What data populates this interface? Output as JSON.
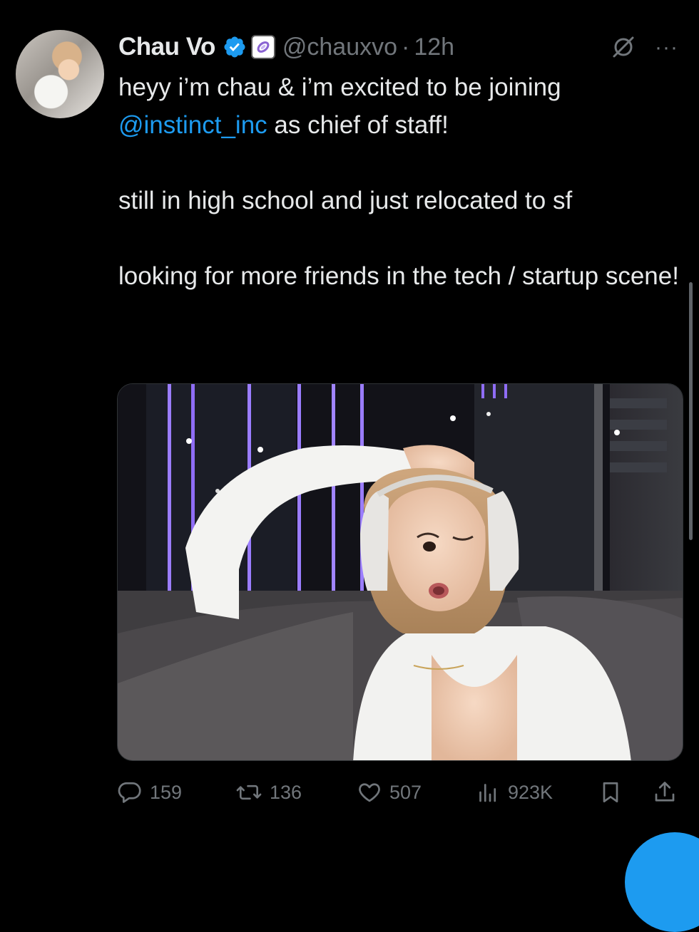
{
  "tweet": {
    "display_name": "Chau Vo",
    "handle": "@chauxvo",
    "separator": "·",
    "time": "12h",
    "more_label": "···",
    "text": {
      "line1_before": "heyy i’m chau & i’m excited to be joining",
      "mention": "@instinct_inc",
      "line1_after": " as chief of staff!",
      "para2": "still in high school and just relocated to sf",
      "para3": "looking for more friends in the tech / startup scene!"
    }
  },
  "actions": {
    "replies": "159",
    "reposts": "136",
    "likes": "507",
    "views": "923K"
  },
  "icons": {
    "verified": "verified-badge-icon",
    "affiliation": "affiliate-org-icon",
    "grok": "grok-icon",
    "more": "more-icon",
    "reply": "reply-icon",
    "repost": "repost-icon",
    "like": "heart-icon",
    "views": "views-icon",
    "bookmark": "bookmark-icon",
    "share": "share-icon"
  },
  "colors": {
    "background": "#000000",
    "text": "#e7e9ea",
    "secondary": "#71767b",
    "accent": "#1d9bf0"
  }
}
